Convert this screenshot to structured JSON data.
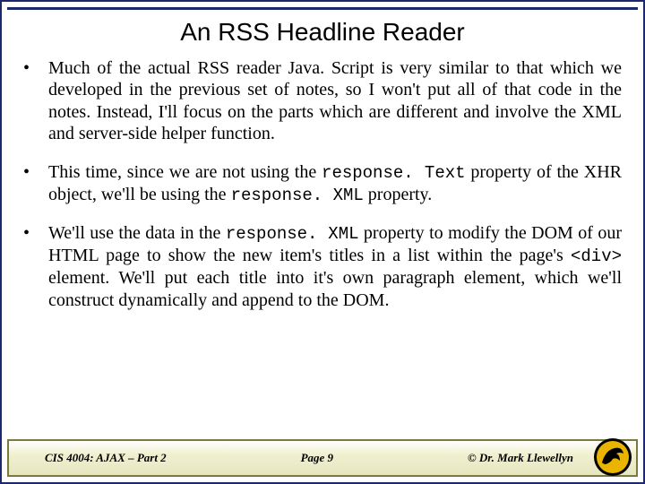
{
  "title": "An RSS Headline Reader",
  "bullets": [
    {
      "segments": [
        {
          "text": "Much of the actual RSS reader Java. Script is very similar to that which we developed in the previous set of notes, so I won't put all of that code in the notes.  Instead, I'll focus on the parts which are different and involve the XML and server-side helper function.",
          "style": "normal"
        }
      ]
    },
    {
      "segments": [
        {
          "text": "This time, since we are not using the ",
          "style": "normal"
        },
        {
          "text": "response. Text",
          "style": "mono"
        },
        {
          "text": " property of the XHR object, we'll be using the ",
          "style": "normal"
        },
        {
          "text": "response. XML",
          "style": "mono"
        },
        {
          "text": " property.",
          "style": "normal"
        }
      ]
    },
    {
      "segments": [
        {
          "text": "We'll use the data in the ",
          "style": "normal"
        },
        {
          "text": "response. XML",
          "style": "mono"
        },
        {
          "text": " property to modify the DOM of our HTML page to show the new item's titles in a list within the page's ",
          "style": "normal"
        },
        {
          "text": "<div>",
          "style": "mono"
        },
        {
          "text": "  element.  We'll put each title into it's own paragraph element, which we'll construct dynamically and append to the DOM.",
          "style": "normal"
        }
      ]
    }
  ],
  "footer": {
    "course": "CIS 4004: AJAX – Part 2",
    "page": "Page 9",
    "author": "© Dr. Mark Llewellyn"
  }
}
